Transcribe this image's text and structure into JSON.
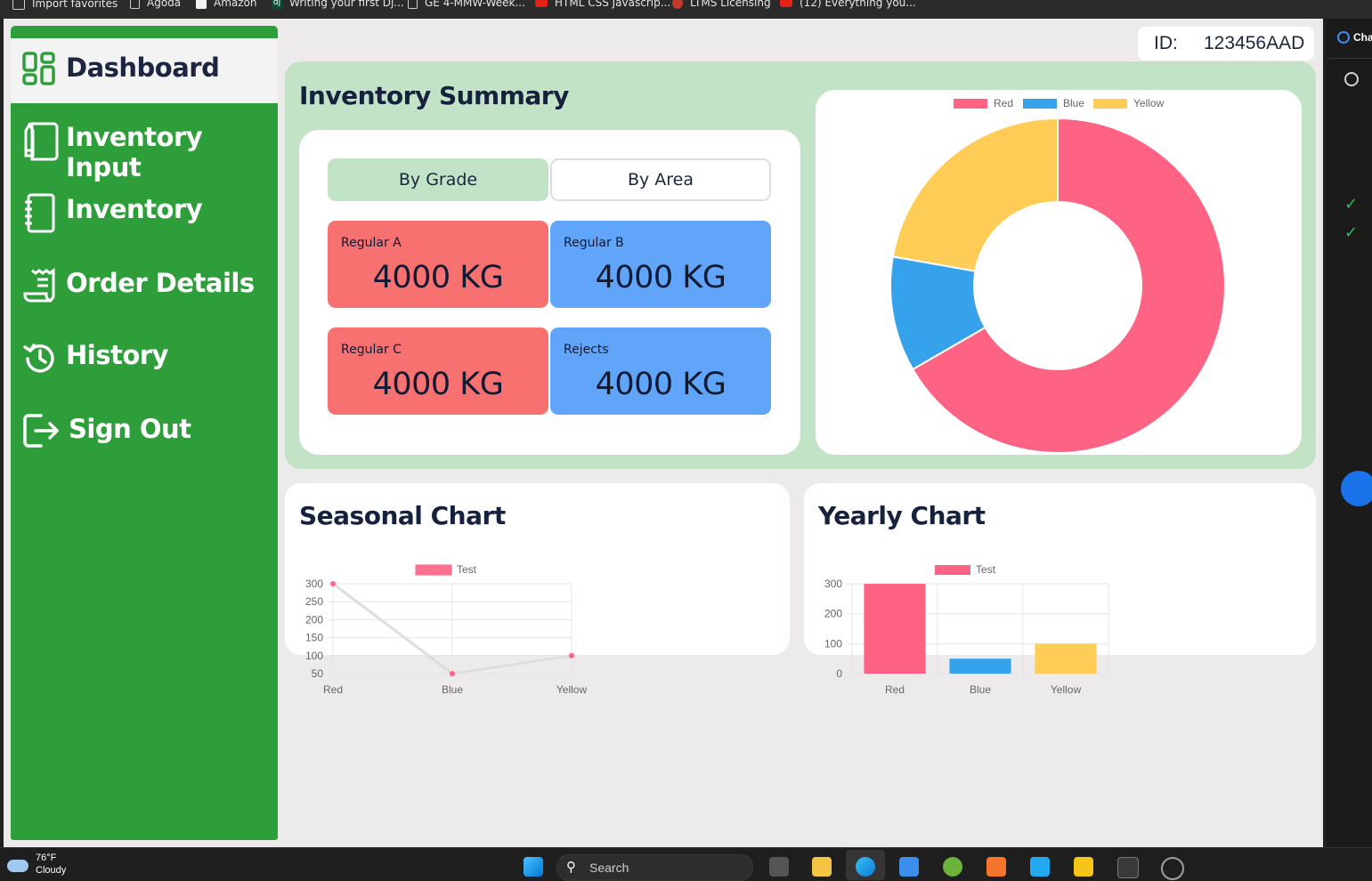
{
  "bookmarks": [
    {
      "label": "Import favorites",
      "icon": "import-icon"
    },
    {
      "label": "Agoda",
      "icon": "page-icon"
    },
    {
      "label": "Amazon",
      "icon": "amazon-icon"
    },
    {
      "label": "Writing your first Dj...",
      "icon": "django-icon"
    },
    {
      "label": "GE 4-MMW-Week...",
      "icon": "page-icon"
    },
    {
      "label": "HTML CSS Javascrip...",
      "icon": "youtube-icon"
    },
    {
      "label": "LTMS Licensing",
      "icon": "ltms-icon"
    },
    {
      "label": "(12) Everything you...",
      "icon": "youtube-icon"
    }
  ],
  "sidebar": {
    "items": [
      {
        "label": "Dashboard",
        "icon": "dashboard-grid-icon",
        "active": true
      },
      {
        "label": "Inventory Input",
        "icon": "notebook-pen-icon"
      },
      {
        "label": "Inventory",
        "icon": "notebook-icon"
      },
      {
        "label": "Order Details",
        "icon": "receipt-icon"
      },
      {
        "label": "History",
        "icon": "history-icon"
      },
      {
        "label": "Sign Out",
        "icon": "sign-out-icon"
      }
    ]
  },
  "header": {
    "id_label": "ID:",
    "id_value": "123456AAD"
  },
  "summary": {
    "title": "Inventory Summary",
    "toggles": {
      "grade": "By Grade",
      "area": "By Area",
      "selected": "grade"
    },
    "stats": [
      {
        "label": "Regular A",
        "value": "4000 KG",
        "color": "#f87171"
      },
      {
        "label": "Regular B",
        "value": "4000 KG",
        "color": "#60a5fa"
      },
      {
        "label": "Regular C",
        "value": "4000 KG",
        "color": "#f87171"
      },
      {
        "label": "Rejects",
        "value": "4000 KG",
        "color": "#60a5fa"
      }
    ]
  },
  "seasonal": {
    "title": "Seasonal Chart"
  },
  "yearly": {
    "title": "Yearly Chart"
  },
  "chart_data": [
    {
      "type": "pie",
      "donut": true,
      "legend_position": "top",
      "categories": [
        "Red",
        "Blue",
        "Yellow"
      ],
      "values": [
        300,
        50,
        100
      ],
      "colors": [
        "#ff6384",
        "#36a2eb",
        "#ffcd56"
      ]
    },
    {
      "type": "line",
      "legend_position": "top",
      "categories": [
        "Red",
        "Blue",
        "Yellow"
      ],
      "series": [
        {
          "name": "Test",
          "values": [
            300,
            50,
            100
          ],
          "color": "#ff6384"
        }
      ],
      "yticks": [
        50,
        100,
        150,
        200,
        250,
        300
      ],
      "ylim": [
        50,
        300
      ],
      "grid": true
    },
    {
      "type": "bar",
      "legend_position": "top",
      "categories": [
        "Red",
        "Blue",
        "Yellow"
      ],
      "series": [
        {
          "name": "Test",
          "values": [
            300,
            50,
            100
          ],
          "colors": [
            "#ff6384",
            "#36a2eb",
            "#ffcd56"
          ]
        }
      ],
      "yticks": [
        0,
        100,
        200,
        300
      ],
      "ylim": [
        0,
        300
      ],
      "grid": true
    }
  ],
  "taskbar": {
    "weather_temp": "76°F",
    "weather_text": "Cloudy",
    "search_placeholder": "Search"
  }
}
